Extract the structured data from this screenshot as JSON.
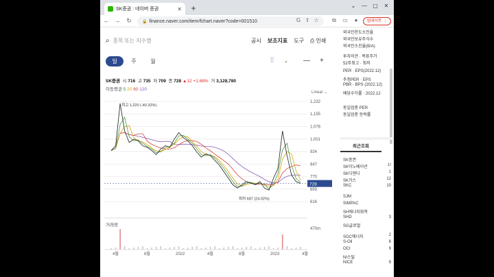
{
  "browser": {
    "tab_title": "SK증권 : 네이버 증권",
    "new_tab": "+",
    "url": "finance.naver.com/item/fchart.naver?code=001510",
    "update_label": "업데이트"
  },
  "header": {
    "search_placeholder": "종목 또는 지수명",
    "menu": [
      "공시",
      "보조지표",
      "도구",
      "인쇄"
    ]
  },
  "periods": [
    {
      "label": "일",
      "active": true
    },
    {
      "label": "주",
      "active": false
    },
    {
      "label": "월",
      "active": false
    }
  ],
  "stock": {
    "name": "SK증권",
    "open_label": "시",
    "open": "716",
    "high_label": "고",
    "high": "735",
    "low_label": "저",
    "low": "709",
    "close_label": "종",
    "close": "728",
    "change": "▲12",
    "change_pct": "+1.68%",
    "volume_label": "거",
    "volume": "3,128,780"
  },
  "ma": {
    "label": "이동평균",
    "values": [
      "5",
      "20",
      "60",
      "120"
    ]
  },
  "scale_label": "Linear",
  "annotations": {
    "max": "최고 1,220 (-40.32%)",
    "min": "최저 687 (24.02%)"
  },
  "volume_title": "거래량",
  "volume_axis": "470m",
  "current_price_tag": "728",
  "chart_data": {
    "type": "line",
    "x_ticks": [
      "4월",
      "8월",
      "2022",
      "4월",
      "8월",
      "2023",
      "4월"
    ],
    "y_ticks": [
      1232,
      1155,
      1078,
      1001,
      924,
      847,
      770,
      693,
      616
    ],
    "ylim": [
      600,
      1240
    ],
    "series": [
      {
        "values": [
          930,
          960,
          1220,
          1050,
          980,
          1000,
          990,
          960,
          950,
          930,
          905,
          940,
          960,
          950,
          1000,
          1040,
          1010,
          990,
          960,
          920,
          890,
          910,
          900,
          870,
          840,
          800,
          760,
          720,
          700,
          720,
          740,
          730,
          720,
          740,
          700,
          687,
          760,
          820,
          1050,
          900,
          780,
          740,
          728
        ]
      }
    ],
    "colors": {
      "price": "#333333",
      "ma5": "#2f8f2f",
      "ma20": "#e0a000",
      "ma60": "#d04040",
      "ma120": "#8a5ab0",
      "tag": "#2b4a8f"
    }
  },
  "sidebar": {
    "top_items": [
      "외국인한도소진율",
      "외국인보유주식수",
      "외국인소진율(B/A)",
      "투자의견 · 목표주가",
      "52주최고 · 최저",
      "PER · EPS(2022.12)",
      "추정PER · EPS",
      "PBR · BPS (2022.12)",
      "배당수익률 · 2022.12",
      "동일업종 PER",
      "동일업종 등락률"
    ],
    "recent_title": "최근조회",
    "recent": [
      {
        "name": "SK증권",
        "v": ""
      },
      {
        "name": "SK이노베이션",
        "v": "1!"
      },
      {
        "name": "SK디앤디",
        "v": "1"
      },
      {
        "name": "SK가스",
        "v": "12"
      },
      {
        "name": "SKC",
        "v": "10"
      },
      {
        "name": "SJM",
        "v": ""
      },
      {
        "name": "SIMPAC",
        "v": ""
      },
      {
        "name": "SH에너지화학",
        "v": ""
      },
      {
        "name": "SHD",
        "v": "3"
      },
      {
        "name": "SG글로벌",
        "v": ""
      },
      {
        "name": "SGC에너지",
        "v": "2"
      },
      {
        "name": "S-Oil",
        "v": "6"
      },
      {
        "name": "OCI",
        "v": "9"
      },
      {
        "name": "NI스틸",
        "v": ""
      },
      {
        "name": "NICE",
        "v": "9"
      }
    ]
  }
}
